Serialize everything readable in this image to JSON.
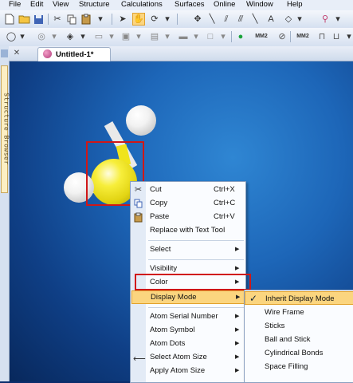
{
  "menubar": {
    "items": [
      "File",
      "Edit",
      "View",
      "Structure",
      "Calculations",
      "Surfaces",
      "Online",
      "Window",
      "Help"
    ]
  },
  "toolbar": {
    "mm2_label_1": "MM2",
    "mm2_label_2": "MM2"
  },
  "side_panel": {
    "label": "Structure Browser"
  },
  "document_tab": {
    "title": "Untitled-1*"
  },
  "context_menu": {
    "items": [
      {
        "label": "Cut",
        "shortcut": "Ctrl+X",
        "icon": "scissors-icon"
      },
      {
        "label": "Copy",
        "shortcut": "Ctrl+C",
        "icon": "copy-icon"
      },
      {
        "label": "Paste",
        "shortcut": "Ctrl+V",
        "icon": "paste-icon"
      },
      {
        "label": "Replace with Text Tool"
      },
      {
        "label": "Select"
      },
      {
        "label": "Visibility"
      },
      {
        "label": "Color"
      },
      {
        "label": "Display Mode"
      },
      {
        "label": "Atom Serial Number"
      },
      {
        "label": "Atom Symbol"
      },
      {
        "label": "Atom Dots"
      },
      {
        "label": "Select Atom Size"
      },
      {
        "label": "Apply Atom Size"
      }
    ]
  },
  "display_mode_submenu": {
    "items": [
      {
        "label": "Inherit Display Mode",
        "checked": true
      },
      {
        "label": "Wire Frame"
      },
      {
        "label": "Sticks"
      },
      {
        "label": "Ball and Stick"
      },
      {
        "label": "Cylindrical Bonds"
      },
      {
        "label": "Space Filling"
      }
    ]
  },
  "colors": {
    "canvas_blue": "#1d66b8",
    "sulfur_yellow": "#f2ea1a",
    "hydrogen_white": "#f2f2f2",
    "highlight": "#fbd57f",
    "annotation_red": "#d01717"
  }
}
